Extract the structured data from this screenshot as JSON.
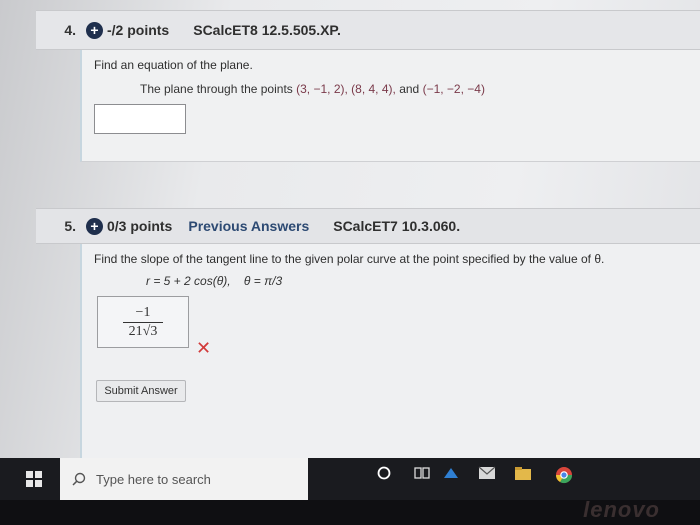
{
  "q4": {
    "number": "4.",
    "points": "-/2 points",
    "source": "SCalcET8 12.5.505.XP.",
    "prompt": "Find an equation of the plane.",
    "plane_text": "The plane through the points",
    "p1": "(3, −1, 2),",
    "p2": "(8, 4, 4),",
    "and": "and",
    "p3": "(−1, −2, −4)",
    "answer_value": ""
  },
  "q5": {
    "number": "5.",
    "points": "0/3 points",
    "previous_answers": "Previous Answers",
    "source": "SCalcET7 10.3.060.",
    "prompt": "Find the slope of the tangent line to the given polar curve at the point specified by the value of θ.",
    "equation": "r = 5 + 2 cos(θ),",
    "theta": "θ = π/3",
    "answer_num": "−1",
    "answer_den": "21√3",
    "submit_label": "Submit Answer"
  },
  "taskbar": {
    "search_placeholder": "Type here to search"
  },
  "bezel": {
    "brand": "lenovo"
  },
  "colors": {
    "accent_icon": "#1f2f4d",
    "wrong_mark": "#d23a3a",
    "taskbar": "#1a1b1f"
  }
}
